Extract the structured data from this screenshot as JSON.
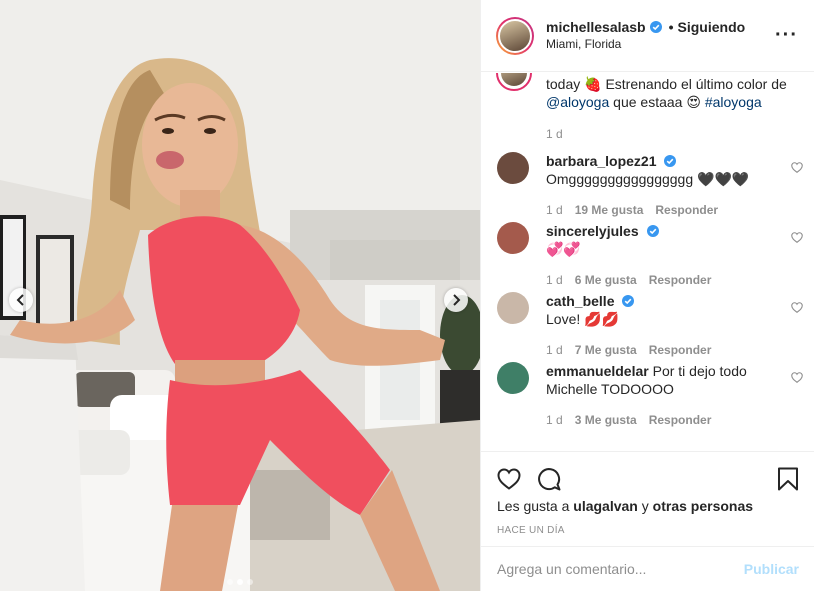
{
  "post": {
    "username": "michellesalasb",
    "follow_status": "Siguiendo",
    "location": "Miami, Florida",
    "more_icon": "more-horizontal-icon"
  },
  "caption": {
    "text_start": "today 🍓 Estrenando el último color de",
    "mention": "@aloyoga",
    "text_mid": " que estaaa 😍 ",
    "hashtag": "#aloyoga",
    "time": "1 d"
  },
  "comments": [
    {
      "user": "barbara_lopez21",
      "verified": true,
      "text": "Omgggggggggggggggg 🖤🖤🖤",
      "time": "1 d",
      "likes": "19 Me gusta",
      "reply": "Responder",
      "avatar_color": "#6b4b3e"
    },
    {
      "user": "sincerelyjules",
      "verified": true,
      "text": "💞💞",
      "time": "1 d",
      "likes": "6 Me gusta",
      "reply": "Responder",
      "avatar_color": "#a45a4c"
    },
    {
      "user": "cath_belle",
      "verified": true,
      "text": "Love! 💋💋",
      "time": "1 d",
      "likes": "7 Me gusta",
      "reply": "Responder",
      "avatar_color": "#c9b7a8"
    },
    {
      "user": "emmanueldelar",
      "verified": false,
      "text": "Por ti dejo todo Michelle TODOOOO",
      "time": "1 d",
      "likes": "3 Me gusta",
      "reply": "Responder",
      "avatar_color": "#3f7f67"
    }
  ],
  "likes_line": {
    "prefix": "Les gusta a",
    "user": "ulagalvan",
    "connector": "y",
    "others": "otras personas"
  },
  "posted_ago": "HACE UN DÍA",
  "comment_box": {
    "placeholder": "Agrega un comentario...",
    "publish_label": "Publicar"
  },
  "carousel": {
    "total": 3,
    "active_index": 1
  },
  "colors": {
    "accent": "#0095f6",
    "publish_disabled": "#b2dffc",
    "outfit": "#f04f5e"
  }
}
